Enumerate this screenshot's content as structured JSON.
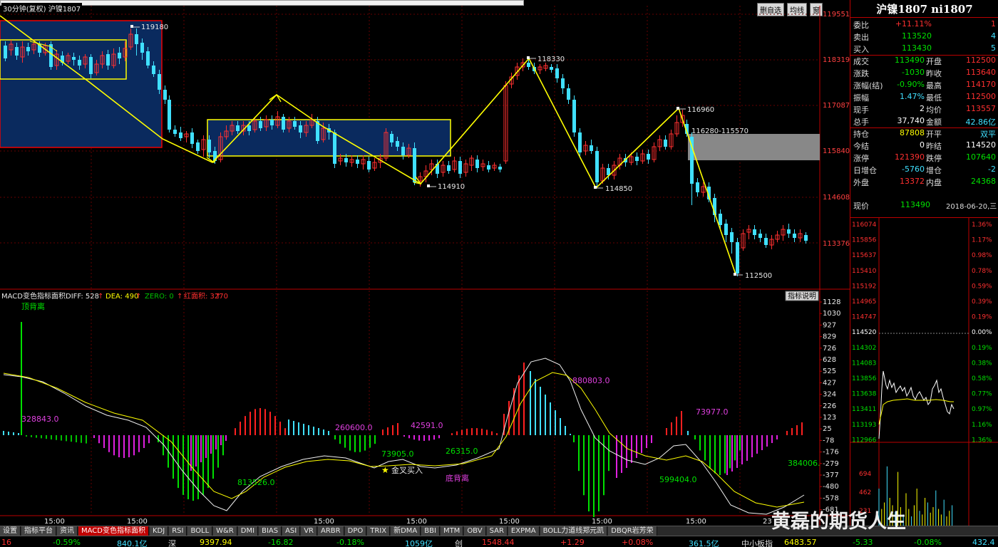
{
  "window": {
    "title": "30分钟(复权)  沪镍1807",
    "buttons": [
      "删自选",
      "均线",
      "窗"
    ]
  },
  "price_axis": [
    "119551",
    "118319",
    "117087",
    "115840",
    "114608",
    "113376"
  ],
  "price_annotations": {
    "high_left": "119180",
    "peak_mid": "118330",
    "low_1": "114910",
    "peak_right": "116960",
    "low_2": "114850",
    "gap_zone": "116280-115570",
    "low_final": "112500"
  },
  "macd": {
    "header_name": "MACD变色指标面积",
    "diff_label": "DIFF: 528",
    "dea_label": "DEA: 490",
    "zero_label": "ZERO: 0",
    "red_area_label": "红面积: 3270",
    "arrow": "↑",
    "note_top": "顶背离",
    "explain_button": "指标说明",
    "axis": [
      "1128",
      "1030",
      "927",
      "829",
      "726",
      "628",
      "525",
      "427",
      "324",
      "226",
      "123",
      "25",
      "-78",
      "-176",
      "-279",
      "-377",
      "-480",
      "-578",
      "-681"
    ],
    "labels": {
      "a1": "328843.0",
      "a2": "813526.0",
      "a3": "260600.0",
      "a4": "42591.0",
      "a5": "73905.0",
      "a6": "26315.0",
      "a7": "880803.0",
      "a8": "73977.0",
      "a9": "599404.0",
      "a10": "384006.",
      "golden": "金叉买入",
      "bottom_div": "底背离"
    }
  },
  "time_axis": [
    "15:00",
    "15:00",
    "15:00",
    "15:00",
    "15:00",
    "15:00",
    "15:00",
    "23"
  ],
  "panel": {
    "title": "沪镍1807 ni1807",
    "rows": [
      {
        "l": "委比",
        "v": "+11.11%",
        "r": "1"
      },
      {
        "l": "卖出",
        "v": "113520",
        "r": "4"
      },
      {
        "l": "买入",
        "v": "113430",
        "r": "5"
      },
      {
        "l": "成交",
        "v": "113490",
        "l2": "开盘",
        "v2": "112500"
      },
      {
        "l": "涨跌",
        "v": "-1030",
        "l2": "昨收",
        "v2": "113640"
      },
      {
        "l": "涨幅(结)",
        "v": "-0.90%",
        "l2": "最高",
        "v2": "114170"
      },
      {
        "l": "振幅",
        "v": "1.47%",
        "l2": "最低",
        "v2": "112500"
      },
      {
        "l": "现手",
        "v": "2",
        "l2": "均价",
        "v2": "113557"
      },
      {
        "l": "总手",
        "v": "37,740",
        "l2": "金额",
        "v2": "42.86亿"
      },
      {
        "l": "持仓",
        "v": "87808",
        "l2": "开平",
        "v2": "双平"
      },
      {
        "l": "今结",
        "v": "0",
        "l2": "昨结",
        "v2": "114520"
      },
      {
        "l": "涨停",
        "v": "121390",
        "l2": "跌停",
        "v2": "107640"
      },
      {
        "l": "日增仓",
        "v": "-5760",
        "l2": "增仓",
        "v2": "-2"
      },
      {
        "l": "外盘",
        "v": "13372",
        "l2": "内盘",
        "v2": "24368"
      }
    ],
    "now_label": "现价",
    "now_price": "113490",
    "now_date": "2018-06-20,三",
    "mini_left": [
      "116074",
      "115856",
      "115637",
      "115410",
      "115192",
      "114965",
      "114747",
      "114520",
      "114302",
      "114083",
      "113856",
      "113638",
      "113411",
      "113193",
      "112966"
    ],
    "mini_right": [
      "1.36%",
      "1.17%",
      "0.98%",
      "0.78%",
      "0.59%",
      "0.39%",
      "0.19%",
      "0.00%",
      "0.19%",
      "0.38%",
      "0.58%",
      "0.77%",
      "0.97%",
      "1.16%",
      "1.36%"
    ],
    "vol_axis": [
      "694",
      "462",
      "231"
    ]
  },
  "tabs": [
    "设置",
    "指标平台",
    "资讯",
    "MACD变色指标面积",
    "KDJ",
    "RSI",
    "BOLL",
    "W&R",
    "DMI",
    "BIAS",
    "ASI",
    "VR",
    "ARBR",
    "DPO",
    "TRIX",
    "新DMA",
    "BBI",
    "MTM",
    "OBV",
    "SAR",
    "EXPMA",
    "BOLL力道线郑元凯",
    "DBQR岩芳荣"
  ],
  "status": {
    "s1": "16",
    "s2": "-0.59%",
    "s3": "840.1亿",
    "s4": "深",
    "s5": "9397.94",
    "s6": "-16.82",
    "s7": "-0.18%",
    "s8": "1059亿",
    "s9": "创",
    "s10": "1548.44",
    "s11": "+1.29",
    "s12": "+0.08%",
    "s13": "361.5亿",
    "s14": "中小板指",
    "s15": "6483.57",
    "s16": "-5.33",
    "s17": "-0.08%",
    "s18": "432.4亿"
  },
  "watermark": "黄磊的期货人生"
}
